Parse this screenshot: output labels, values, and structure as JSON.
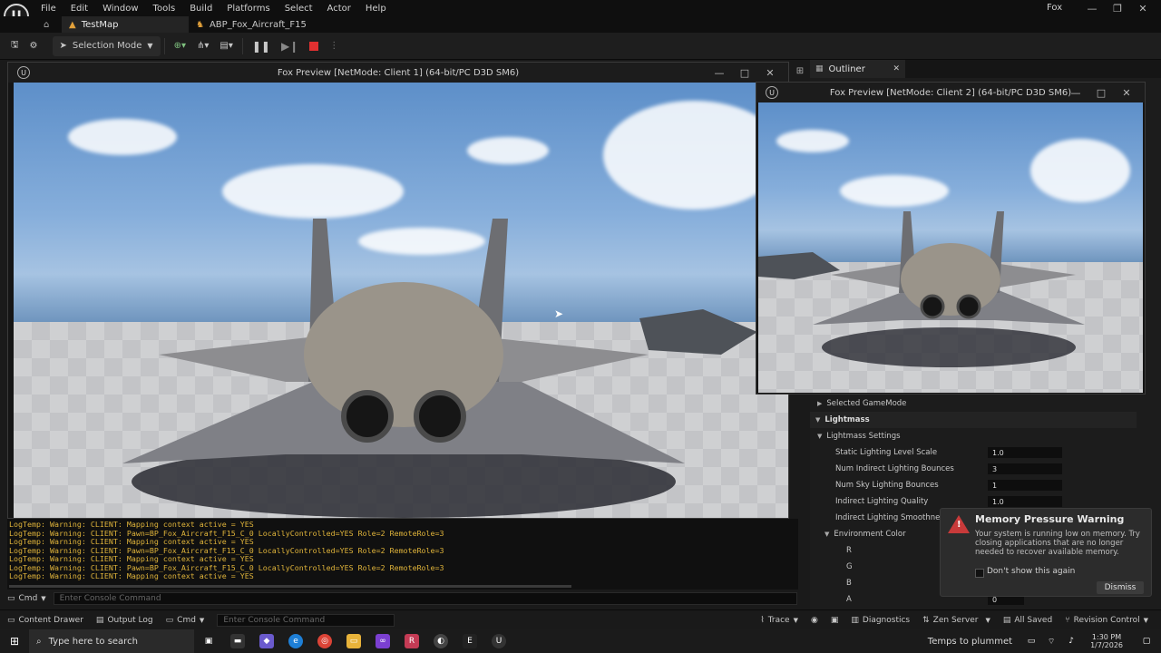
{
  "menu": [
    "File",
    "Edit",
    "Window",
    "Tools",
    "Build",
    "Platforms",
    "Select",
    "Actor",
    "Help"
  ],
  "window": {
    "user": "Fox",
    "minimize": "—",
    "maximize": "❐",
    "close": "✕"
  },
  "tabs": [
    {
      "label": "TestMap",
      "active": true
    },
    {
      "label": "ABP_Fox_Aircraft_F15",
      "active": false
    }
  ],
  "toolbar": {
    "selection_mode": "Selection Mode"
  },
  "client1": {
    "title": "Fox Preview [NetMode: Client 1]  (64-bit/PC D3D SM6)"
  },
  "client2": {
    "title": "Fox Preview [NetMode: Client 2]  (64-bit/PC D3D SM6)"
  },
  "outliner": {
    "label": "Outliner"
  },
  "log_lines": [
    "LogTemp: Warning: CLIENT: Mapping context active = YES",
    "LogTemp: Warning: CLIENT: Pawn=BP_Fox_Aircraft_F15_C_0 LocallyControlled=YES Role=2 RemoteRole=3",
    "LogTemp: Warning: CLIENT: Mapping context active = YES",
    "LogTemp: Warning: CLIENT: Pawn=BP_Fox_Aircraft_F15_C_0 LocallyControlled=YES Role=2 RemoteRole=3",
    "LogTemp: Warning: CLIENT: Mapping context active = YES",
    "LogTemp: Warning: CLIENT: Pawn=BP_Fox_Aircraft_F15_C_0 LocallyControlled=YES Role=2 RemoteRole=3",
    "LogTemp: Warning: CLIENT: Mapping context active = YES"
  ],
  "console": {
    "cmd_label": "Cmd",
    "placeholder": "Enter Console Command"
  },
  "details": {
    "selected_gamemode": "Selected GameMode",
    "lightmass": "Lightmass",
    "lightmass_settings": "Lightmass Settings",
    "rows": [
      {
        "label": "Static Lighting Level Scale",
        "value": "1.0"
      },
      {
        "label": "Num Indirect Lighting Bounces",
        "value": "3"
      },
      {
        "label": "Num Sky Lighting Bounces",
        "value": "1"
      },
      {
        "label": "Indirect Lighting Quality",
        "value": "1.0"
      },
      {
        "label": "Indirect Lighting Smoothness",
        "value": ""
      }
    ],
    "environment_color": "Environment Color",
    "channels": [
      "R",
      "G",
      "B",
      "A"
    ],
    "alpha_value": "0"
  },
  "notification": {
    "title": "Memory Pressure Warning",
    "body": "Your system is running low on memory. Try closing applications that are no longer needed to recover available memory.",
    "checkbox": "Don't show this again",
    "dismiss": "Dismiss"
  },
  "statusbar": {
    "content_drawer": "Content Drawer",
    "output_log": "Output Log",
    "cmd": "Cmd",
    "placeholder": "Enter Console Command",
    "trace": "Trace",
    "diagnostics": "Diagnostics",
    "zen_server": "Zen Server",
    "all_saved": "All Saved",
    "revision_control": "Revision Control"
  },
  "taskbar": {
    "search_placeholder": "Type here to search",
    "weather": "Temps to plummet",
    "time": "1:30 PM",
    "date": "1/7/2026"
  }
}
